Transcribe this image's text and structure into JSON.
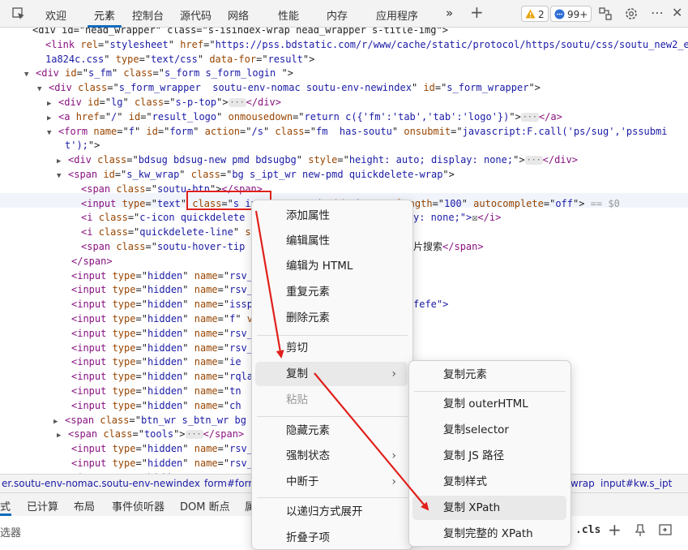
{
  "topbar": {
    "tabs": [
      "欢迎",
      "元素",
      "控制台",
      "源代码",
      "网络",
      "性能",
      "内存",
      "应用程序"
    ],
    "warnings": "2",
    "messages": "99+"
  },
  "code_lines": [
    {
      "segs": [
        [
          "x",
          "<div id=\"head_wrapper\" class=\"s-isindex-wrap head_wrapper s-title-img\">"
        ]
      ]
    },
    {
      "segs": [
        [
          "t",
          "<link "
        ],
        [
          "a",
          "rel"
        ],
        [
          "x",
          "=\""
        ],
        [
          "v",
          "stylesheet"
        ],
        [
          "x",
          "\" "
        ],
        [
          "a",
          "href"
        ],
        [
          "x",
          "=\""
        ],
        [
          "v",
          "https://pss.bdstatic.com/r/www/cache/static/protocol/https/soutu/css/soutu_new2_e"
        ],
        [
          "x",
          ""
        ]
      ]
    },
    {
      "segs": [
        [
          "v",
          "1a824c.css"
        ],
        [
          "x",
          "\" "
        ],
        [
          "a",
          "type"
        ],
        [
          "x",
          "=\""
        ],
        [
          "v",
          "text/css"
        ],
        [
          "x",
          "\" "
        ],
        [
          "a",
          "data-for"
        ],
        [
          "x",
          "=\""
        ],
        [
          "v",
          "result"
        ],
        [
          "x",
          "\">"
        ]
      ]
    },
    {
      "segs": [
        [
          "t",
          "<div "
        ],
        [
          "a",
          "id"
        ],
        [
          "x",
          "=\""
        ],
        [
          "v",
          "s_fm"
        ],
        [
          "x",
          "\" "
        ],
        [
          "a",
          "class"
        ],
        [
          "x",
          "=\""
        ],
        [
          "v",
          "s_form s_form_login "
        ],
        [
          "x",
          "\">"
        ]
      ]
    },
    {
      "segs": [
        [
          "t",
          "<div "
        ],
        [
          "a",
          "class"
        ],
        [
          "x",
          "=\""
        ],
        [
          "v",
          "s_form_wrapper  soutu-env-nomac soutu-env-newindex"
        ],
        [
          "x",
          "\" "
        ],
        [
          "a",
          "id"
        ],
        [
          "x",
          "=\""
        ],
        [
          "v",
          "s_form_wrapper"
        ],
        [
          "x",
          "\">"
        ]
      ]
    },
    {
      "segs": [
        [
          "t",
          "<div "
        ],
        [
          "a",
          "id"
        ],
        [
          "x",
          "=\""
        ],
        [
          "v",
          "lg"
        ],
        [
          "x",
          "\" "
        ],
        [
          "a",
          "class"
        ],
        [
          "x",
          "=\""
        ],
        [
          "v",
          "s-p-top"
        ],
        [
          "x",
          "\">"
        ],
        [
          "dots",
          "···"
        ],
        [
          "t",
          "</div>"
        ]
      ]
    },
    {
      "segs": [
        [
          "t",
          "<a "
        ],
        [
          "a",
          "href"
        ],
        [
          "x",
          "=\""
        ],
        [
          "v",
          "/"
        ],
        [
          "x",
          "\" "
        ],
        [
          "a",
          "id"
        ],
        [
          "x",
          "=\""
        ],
        [
          "v",
          "result_logo"
        ],
        [
          "x",
          "\" "
        ],
        [
          "a",
          "onmousedown"
        ],
        [
          "x",
          "=\""
        ],
        [
          "v",
          "return c({'fm':'tab','tab':'logo'})"
        ],
        [
          "x",
          "\">"
        ],
        [
          "dots",
          "···"
        ],
        [
          "t",
          "</a>"
        ]
      ]
    },
    {
      "segs": [
        [
          "t",
          "<form "
        ],
        [
          "a",
          "name"
        ],
        [
          "x",
          "=\""
        ],
        [
          "v",
          "f"
        ],
        [
          "x",
          "\" "
        ],
        [
          "a",
          "id"
        ],
        [
          "x",
          "=\""
        ],
        [
          "v",
          "form"
        ],
        [
          "x",
          "\" "
        ],
        [
          "a",
          "action"
        ],
        [
          "x",
          "=\""
        ],
        [
          "v",
          "/s"
        ],
        [
          "x",
          "\" "
        ],
        [
          "a",
          "class"
        ],
        [
          "x",
          "=\""
        ],
        [
          "v",
          "fm  has-soutu"
        ],
        [
          "x",
          "\" "
        ],
        [
          "a",
          "onsubmit"
        ],
        [
          "x",
          "=\""
        ],
        [
          "v",
          "javascript:F.call('ps/sug','pssubmi"
        ]
      ]
    },
    {
      "segs": [
        [
          "v",
          "t');"
        ],
        [
          "x",
          "\">"
        ]
      ]
    },
    {
      "segs": [
        [
          "t",
          "<div "
        ],
        [
          "a",
          "class"
        ],
        [
          "x",
          "=\""
        ],
        [
          "v",
          "bdsug bdsug-new pmd bdsugbg"
        ],
        [
          "x",
          "\" "
        ],
        [
          "a",
          "style"
        ],
        [
          "x",
          "=\""
        ],
        [
          "v",
          "height: auto; display: none;"
        ],
        [
          "x",
          "\">"
        ],
        [
          "dots",
          "···"
        ],
        [
          "t",
          "</div>"
        ]
      ]
    },
    {
      "segs": [
        [
          "t",
          "<span "
        ],
        [
          "a",
          "id"
        ],
        [
          "x",
          "=\""
        ],
        [
          "v",
          "s_kw_wrap"
        ],
        [
          "x",
          "\" "
        ],
        [
          "a",
          "class"
        ],
        [
          "x",
          "=\""
        ],
        [
          "v",
          "bg s_ipt_wr new-pmd quickdelete-wrap"
        ],
        [
          "x",
          "\">"
        ]
      ]
    },
    {
      "segs": [
        [
          "t",
          "<span "
        ],
        [
          "a",
          "class"
        ],
        [
          "x",
          "=\""
        ],
        [
          "v",
          "soutu-btn"
        ],
        [
          "x",
          "\">"
        ],
        [
          "t",
          "</span>"
        ]
      ]
    },
    {
      "segs": [
        [
          "t",
          "<input "
        ],
        [
          "a",
          "type"
        ],
        [
          "x",
          "=\""
        ],
        [
          "v",
          "text"
        ],
        [
          "x",
          "\" "
        ],
        [
          "a",
          "class"
        ],
        [
          "x",
          "=\""
        ],
        [
          "v",
          "s_ipt"
        ],
        [
          "x",
          "\" "
        ],
        [
          "a",
          "name"
        ],
        [
          "x",
          "=\""
        ],
        [
          "v",
          "wd"
        ],
        [
          "x",
          "\" "
        ],
        [
          "a",
          "id"
        ],
        [
          "x",
          "=\""
        ],
        [
          "v",
          "kw"
        ],
        [
          "x",
          "\" "
        ],
        [
          "a",
          "maxlength"
        ],
        [
          "x",
          "=\""
        ],
        [
          "v",
          "100"
        ],
        [
          "x",
          "\" "
        ],
        [
          "a",
          "autocomplete"
        ],
        [
          "x",
          "=\""
        ],
        [
          "v",
          "off"
        ],
        [
          "x",
          "\">"
        ],
        [
          "g",
          " == $0"
        ]
      ]
    },
    {
      "segs": [
        [
          "t",
          "<i "
        ],
        [
          "a",
          "class"
        ],
        [
          "x",
          "=\""
        ],
        [
          "v",
          "c-icon quickdelete "
        ]
      ]
    },
    {
      "segs": [
        [
          "t",
          "<i "
        ],
        [
          "a",
          "class"
        ],
        [
          "x",
          "=\""
        ],
        [
          "v",
          "quickdelete-line"
        ],
        [
          "x",
          "\" "
        ],
        [
          "a",
          "st"
        ]
      ]
    },
    {
      "segs": [
        [
          "t",
          "<span "
        ],
        [
          "a",
          "class"
        ],
        [
          "x",
          "=\""
        ],
        [
          "v",
          "soutu-hover-tip"
        ]
      ]
    },
    {
      "segs": [
        [
          "t",
          "</span>"
        ]
      ]
    },
    {
      "segs": [
        [
          "t",
          "<input "
        ],
        [
          "a",
          "type"
        ],
        [
          "x",
          "=\""
        ],
        [
          "v",
          "hidden"
        ],
        [
          "x",
          "\" "
        ],
        [
          "a",
          "name"
        ],
        [
          "x",
          "=\""
        ],
        [
          "v",
          "rsv_"
        ]
      ]
    },
    {
      "segs": [
        [
          "t",
          "<input "
        ],
        [
          "a",
          "type"
        ],
        [
          "x",
          "=\""
        ],
        [
          "v",
          "hidden"
        ],
        [
          "x",
          "\" "
        ],
        [
          "a",
          "name"
        ],
        [
          "x",
          "=\""
        ],
        [
          "v",
          "rsv_"
        ]
      ]
    },
    {
      "segs": [
        [
          "t",
          "<input "
        ],
        [
          "a",
          "type"
        ],
        [
          "x",
          "=\""
        ],
        [
          "v",
          "hidden"
        ],
        [
          "x",
          "\" "
        ],
        [
          "a",
          "name"
        ],
        [
          "x",
          "=\""
        ],
        [
          "v",
          "issp"
        ]
      ]
    },
    {
      "segs": [
        [
          "t",
          "<input "
        ],
        [
          "a",
          "type"
        ],
        [
          "x",
          "=\""
        ],
        [
          "v",
          "hidden"
        ],
        [
          "x",
          "\" "
        ],
        [
          "a",
          "name"
        ],
        [
          "x",
          "=\""
        ],
        [
          "v",
          "f"
        ],
        [
          "x",
          "\" "
        ],
        [
          "a",
          "v"
        ]
      ]
    },
    {
      "segs": [
        [
          "t",
          "<input "
        ],
        [
          "a",
          "type"
        ],
        [
          "x",
          "=\""
        ],
        [
          "v",
          "hidden"
        ],
        [
          "x",
          "\" "
        ],
        [
          "a",
          "name"
        ],
        [
          "x",
          "=\""
        ],
        [
          "v",
          "rsv_"
        ]
      ]
    },
    {
      "segs": [
        [
          "t",
          "<input "
        ],
        [
          "a",
          "type"
        ],
        [
          "x",
          "=\""
        ],
        [
          "v",
          "hidden"
        ],
        [
          "x",
          "\" "
        ],
        [
          "a",
          "name"
        ],
        [
          "x",
          "=\""
        ],
        [
          "v",
          "rsv_"
        ]
      ]
    },
    {
      "segs": [
        [
          "t",
          "<input "
        ],
        [
          "a",
          "type"
        ],
        [
          "x",
          "=\""
        ],
        [
          "v",
          "hidden"
        ],
        [
          "x",
          "\" "
        ],
        [
          "a",
          "name"
        ],
        [
          "x",
          "=\""
        ],
        [
          "v",
          "ie"
        ]
      ]
    },
    {
      "segs": [
        [
          "t",
          "<input "
        ],
        [
          "a",
          "type"
        ],
        [
          "x",
          "=\""
        ],
        [
          "v",
          "hidden"
        ],
        [
          "x",
          "\" "
        ],
        [
          "a",
          "name"
        ],
        [
          "x",
          "=\""
        ],
        [
          "v",
          "rqla"
        ]
      ]
    },
    {
      "segs": [
        [
          "t",
          "<input "
        ],
        [
          "a",
          "type"
        ],
        [
          "x",
          "=\""
        ],
        [
          "v",
          "hidden"
        ],
        [
          "x",
          "\" "
        ],
        [
          "a",
          "name"
        ],
        [
          "x",
          "=\""
        ],
        [
          "v",
          "tn"
        ]
      ]
    },
    {
      "segs": [
        [
          "t",
          "<input "
        ],
        [
          "a",
          "type"
        ],
        [
          "x",
          "=\""
        ],
        [
          "v",
          "hidden"
        ],
        [
          "x",
          "\" "
        ],
        [
          "a",
          "name"
        ],
        [
          "x",
          "=\""
        ],
        [
          "v",
          "ch"
        ]
      ]
    },
    {
      "segs": [
        [
          "t",
          "<span "
        ],
        [
          "a",
          "class"
        ],
        [
          "x",
          "=\""
        ],
        [
          "v",
          "btn_wr s_btn_wr bg"
        ]
      ]
    },
    {
      "segs": [
        [
          "t",
          "<span "
        ],
        [
          "a",
          "class"
        ],
        [
          "x",
          "=\""
        ],
        [
          "v",
          "tools"
        ],
        [
          "x",
          "\">"
        ],
        [
          "dots",
          "···"
        ],
        [
          "t",
          "</span>"
        ]
      ]
    },
    {
      "segs": [
        [
          "t",
          "<input "
        ],
        [
          "a",
          "type"
        ],
        [
          "x",
          "=\""
        ],
        [
          "v",
          "hidden"
        ],
        [
          "x",
          "\" "
        ],
        [
          "a",
          "name"
        ],
        [
          "x",
          "=\""
        ],
        [
          "v",
          "rsv_"
        ]
      ]
    },
    {
      "segs": [
        [
          "t",
          "<input "
        ],
        [
          "a",
          "type"
        ],
        [
          "x",
          "=\""
        ],
        [
          "v",
          "hidden"
        ],
        [
          "x",
          "\" "
        ],
        [
          "a",
          "name"
        ],
        [
          "x",
          "=\""
        ],
        [
          "v",
          "rsv_"
        ]
      ]
    },
    {
      "segs": [
        [
          "t",
          "<input "
        ],
        [
          "a",
          "type"
        ],
        [
          "x",
          "=\""
        ],
        [
          "v",
          "hidden"
        ],
        [
          "x",
          "\" "
        ],
        [
          "a",
          "name"
        ],
        [
          "x",
          "=\""
        ],
        [
          "v",
          "rsv_"
        ]
      ]
    }
  ],
  "code_tail": {
    "line13_tail": "y: none;\">",
    "line13_box": "☒",
    "line13_close": "</i>",
    "line15_tail": "片搜索",
    "line15_close": "</span>",
    "line19_tail": "fefe\">"
  },
  "breadcrumbs": {
    "left": "er.soutu-env-nomac.soutu-env-newindex",
    "mid": "form#form",
    "wrap": "wrap",
    "selected": "input#kw.s_ipt"
  },
  "bottom_tabs": [
    "式",
    "已计算",
    "布局",
    "事件侦听器",
    "DOM 断点",
    "属"
  ],
  "filter": {
    "placeholder": "选器",
    "cls": ".cls"
  },
  "context_menu": {
    "items": [
      "添加属性",
      "编辑属性",
      "编辑为 HTML",
      "重复元素",
      "删除元素",
      "剪切",
      "复制",
      "粘贴",
      "隐藏元素",
      "强制状态",
      "中断于",
      "以递归方式展开",
      "折叠子项"
    ]
  },
  "copy_submenu": {
    "items": [
      "复制元素",
      "复制 outerHTML",
      "复制selector",
      "复制 JS 路径",
      "复制样式",
      "复制 XPath",
      "复制完整的 XPath"
    ]
  },
  "colors": {
    "accent": "#0f6cbd",
    "annotation_red": "#e0201b"
  }
}
